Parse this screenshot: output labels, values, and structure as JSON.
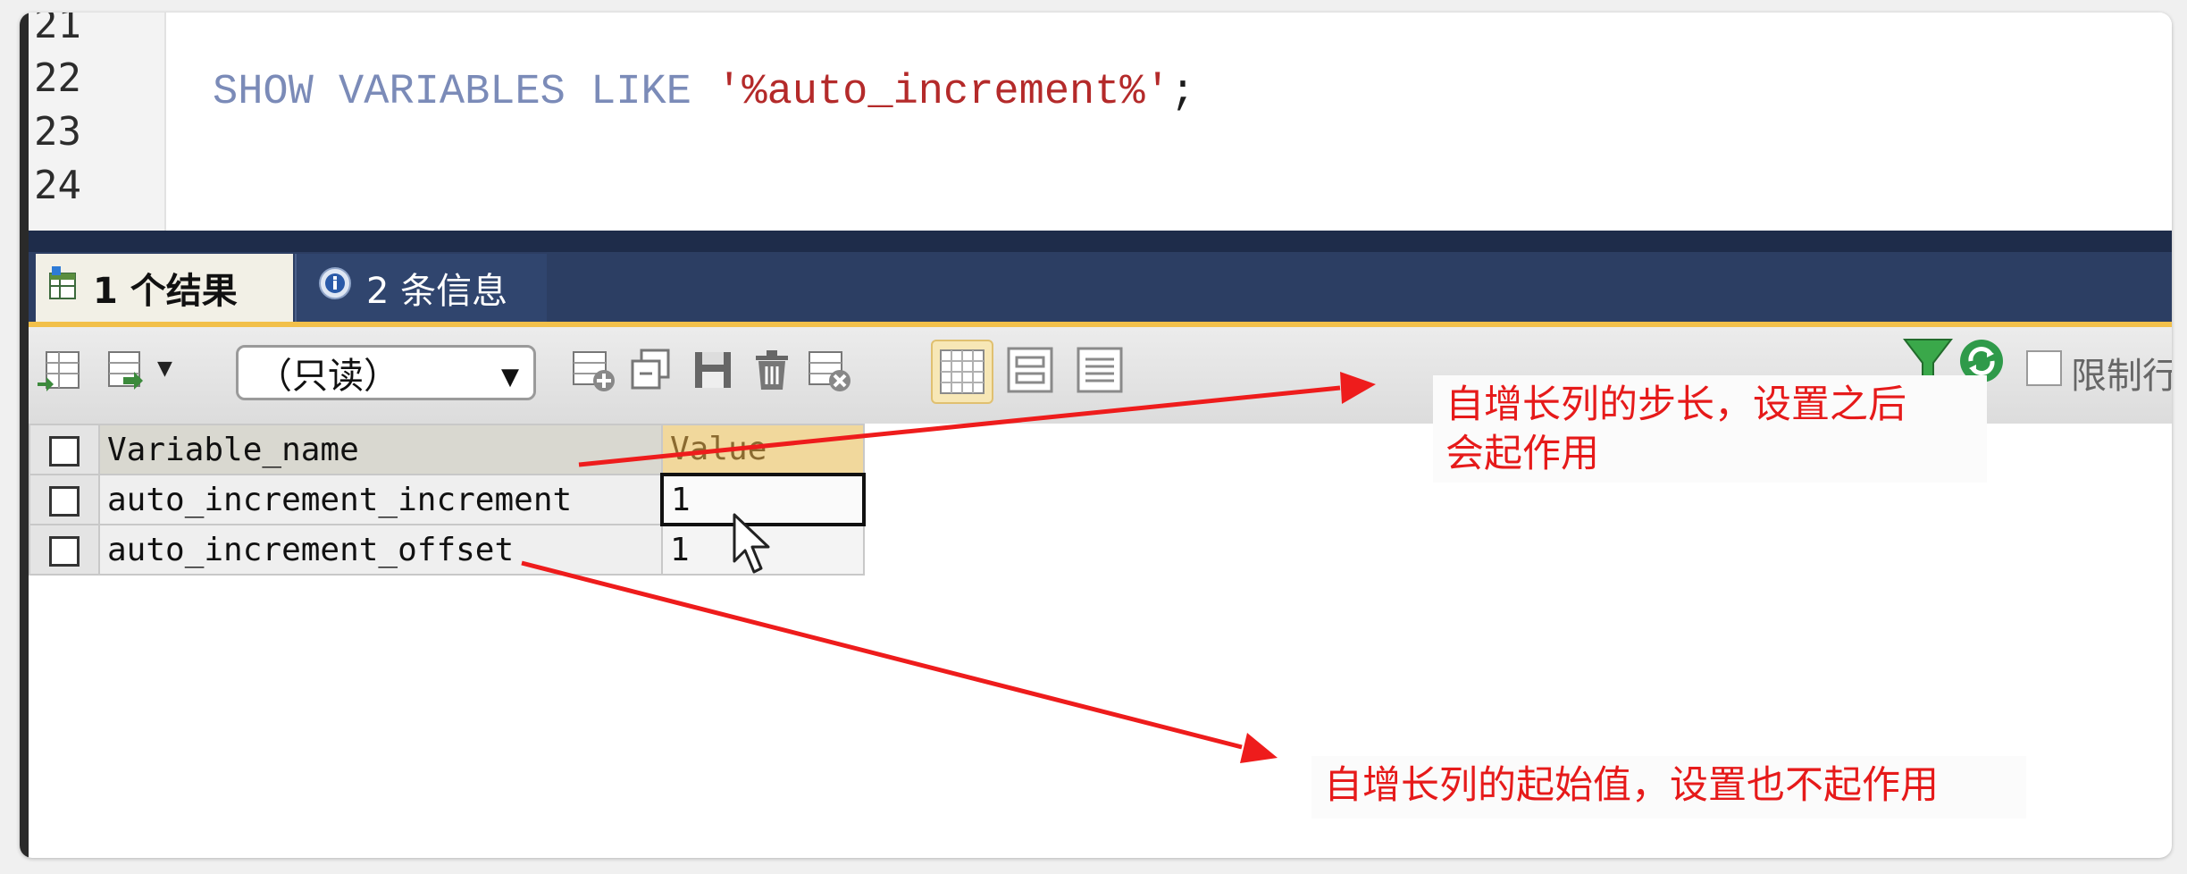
{
  "editor": {
    "line_numbers": [
      "21",
      "22",
      "23",
      "24"
    ],
    "code": {
      "keyword_1": "SHOW",
      "keyword_2": "VARIABLES",
      "keyword_3": "LIKE",
      "string": "'%auto_increment%'",
      "terminator": ";"
    }
  },
  "result_tabs": [
    {
      "label": "1 个结果",
      "icon": "table-result-icon",
      "active": true
    },
    {
      "label": "2 条信息",
      "icon": "info-icon",
      "active": false
    }
  ],
  "toolbar": {
    "mode_select_value": "（只读）",
    "limit_label": "限制行"
  },
  "grid": {
    "columns": [
      "Variable_name",
      "Value"
    ],
    "rows": [
      {
        "name": "auto_increment_increment",
        "value": "1"
      },
      {
        "name": "auto_increment_offset",
        "value": "1"
      }
    ]
  },
  "annotations": {
    "increment_note_line1": "自增长列的步长，设置之后",
    "increment_note_line2": "会起作用",
    "offset_note": "自增长列的起始值，设置也不起作用"
  },
  "colors": {
    "annotation": "#e61a1a",
    "tab_bar": "#2c3e63",
    "keyword": "#7b8bb8",
    "string": "#b42a2a"
  }
}
